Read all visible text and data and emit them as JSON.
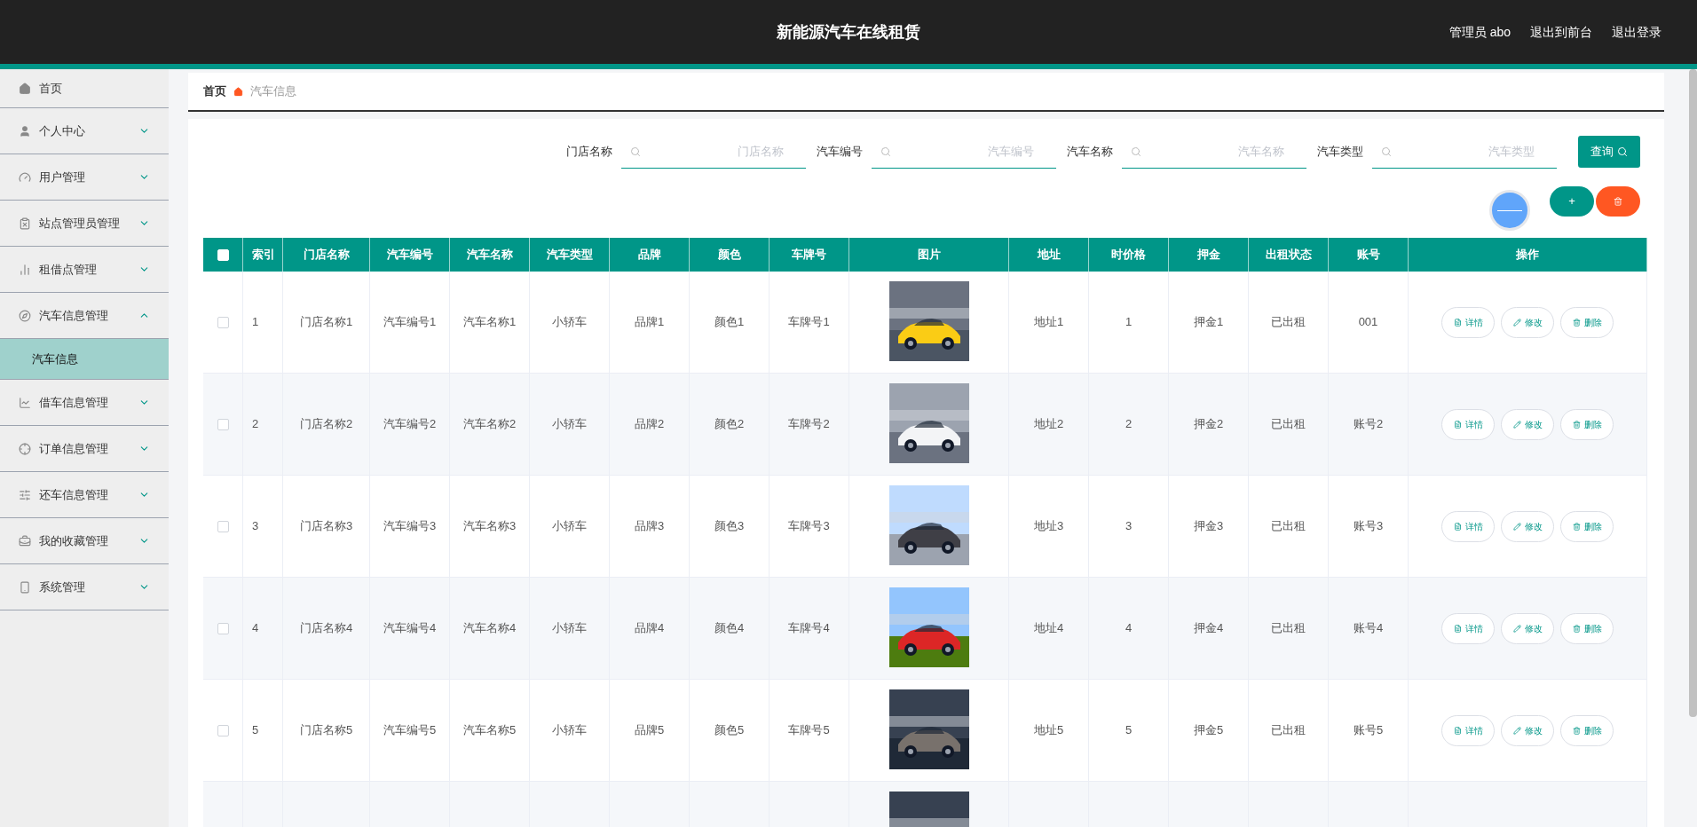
{
  "header": {
    "title": "新能源汽车在线租赁",
    "links": [
      "管理员 abo",
      "退出到前台",
      "退出登录"
    ]
  },
  "sidebar": {
    "items": [
      {
        "label": "首页"
      },
      {
        "label": "个人中心",
        "expanded": false
      },
      {
        "label": "用户管理",
        "expanded": false
      },
      {
        "label": "站点管理员管理",
        "expanded": false
      },
      {
        "label": "租借点管理",
        "expanded": false
      },
      {
        "label": "汽车信息管理",
        "expanded": true,
        "children": [
          {
            "label": "汽车信息",
            "selected": true
          }
        ]
      },
      {
        "label": "借车信息管理",
        "expanded": false
      },
      {
        "label": "订单信息管理",
        "expanded": false
      },
      {
        "label": "还车信息管理",
        "expanded": false
      },
      {
        "label": "我的收藏管理",
        "expanded": false
      },
      {
        "label": "系统管理",
        "expanded": false
      }
    ]
  },
  "breadcrumb": [
    "首页",
    "汽车信息"
  ],
  "search": {
    "fields": [
      {
        "label": "门店名称",
        "placeholder": "门店名称"
      },
      {
        "label": "汽车编号",
        "placeholder": "汽车编号"
      },
      {
        "label": "汽车名称",
        "placeholder": "汽车名称"
      },
      {
        "label": "汽车类型",
        "placeholder": "汽车类型"
      }
    ],
    "button": "查询"
  },
  "toolbar": {
    "add": "+"
  },
  "table": {
    "select_all": {
      "checked": false
    },
    "columns": [
      "索引",
      "门店名称",
      "汽车编号",
      "汽车名称",
      "汽车类型",
      "品牌",
      "颜色",
      "车牌号",
      "图片",
      "地址",
      "时价格",
      "押金",
      "出租状态",
      "账号",
      "操作"
    ],
    "rows": [
      {
        "checked": false,
        "cells": [
          "1",
          "门店名称1",
          "汽车编号1",
          "汽车名称1",
          "小轿车",
          "品牌1",
          "颜色1",
          "车牌号1",
          "地址1",
          "1",
          "押金1",
          "已出租",
          "001"
        ],
        "image": {
          "kind": "picture"
        },
        "actions": [
          "详情",
          "修改",
          "删除"
        ]
      },
      {
        "checked": false,
        "cells": [
          "2",
          "门店名称2",
          "汽车编号2",
          "汽车名称2",
          "小轿车",
          "品牌2",
          "颜色2",
          "车牌号2",
          "地址2",
          "2",
          "押金2",
          "已出租",
          "账号2"
        ],
        "image": {
          "kind": "picture"
        },
        "actions": [
          "详情",
          "修改",
          "删除"
        ]
      },
      {
        "checked": false,
        "cells": [
          "3",
          "门店名称3",
          "汽车编号3",
          "汽车名称3",
          "小轿车",
          "品牌3",
          "颜色3",
          "车牌号3",
          "地址3",
          "3",
          "押金3",
          "已出租",
          "账号3"
        ],
        "image": {
          "kind": "picture"
        },
        "actions": [
          "详情",
          "修改",
          "删除"
        ]
      },
      {
        "checked": false,
        "cells": [
          "4",
          "门店名称4",
          "汽车编号4",
          "汽车名称4",
          "小轿车",
          "品牌4",
          "颜色4",
          "车牌号4",
          "地址4",
          "4",
          "押金4",
          "已出租",
          "账号4"
        ],
        "image": {
          "kind": "picture"
        },
        "actions": [
          "详情",
          "修改",
          "删除"
        ]
      },
      {
        "checked": false,
        "cells": [
          "5",
          "门店名称5",
          "汽车编号5",
          "汽车名称5",
          "小轿车",
          "品牌5",
          "颜色5",
          "车牌号5",
          "地址5",
          "5",
          "押金5",
          "已出租",
          "账号5"
        ],
        "image": {
          "kind": "picture"
        },
        "actions": [
          "详情",
          "修改",
          "删除"
        ]
      },
      {
        "image": {
          "kind": "picture"
        }
      }
    ]
  }
}
